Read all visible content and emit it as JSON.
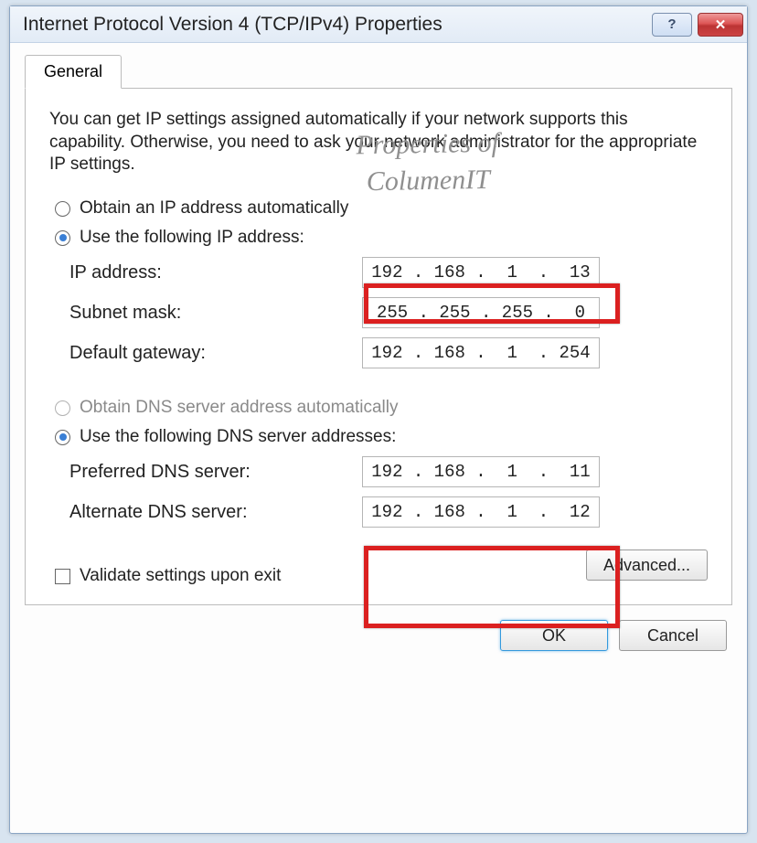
{
  "window": {
    "title": "Internet Protocol Version 4 (TCP/IPv4) Properties"
  },
  "tab": {
    "label": "General"
  },
  "description": "You can get IP settings assigned automatically if your network supports this capability. Otherwise, you need to ask your network administrator for the appropriate IP settings.",
  "ip_section": {
    "auto_label": "Obtain an IP address automatically",
    "manual_label": "Use the following IP address:",
    "fields": {
      "ip_label": "IP address:",
      "ip_value": "192 . 168 .  1  .  13",
      "mask_label": "Subnet mask:",
      "mask_value": "255 . 255 . 255 .  0",
      "gw_label": "Default gateway:",
      "gw_value": "192 . 168 .  1  . 254"
    }
  },
  "dns_section": {
    "auto_label": "Obtain DNS server address automatically",
    "manual_label": "Use the following DNS server addresses:",
    "fields": {
      "pref_label": "Preferred DNS server:",
      "pref_value": "192 . 168 .  1  .  11",
      "alt_label": "Alternate DNS server:",
      "alt_value": "192 . 168 .  1  .  12"
    }
  },
  "validate_label": "Validate settings upon exit",
  "buttons": {
    "advanced": "Advanced...",
    "ok": "OK",
    "cancel": "Cancel"
  },
  "watermark": {
    "l1": "Properties of",
    "l2": "ColumenIT"
  }
}
